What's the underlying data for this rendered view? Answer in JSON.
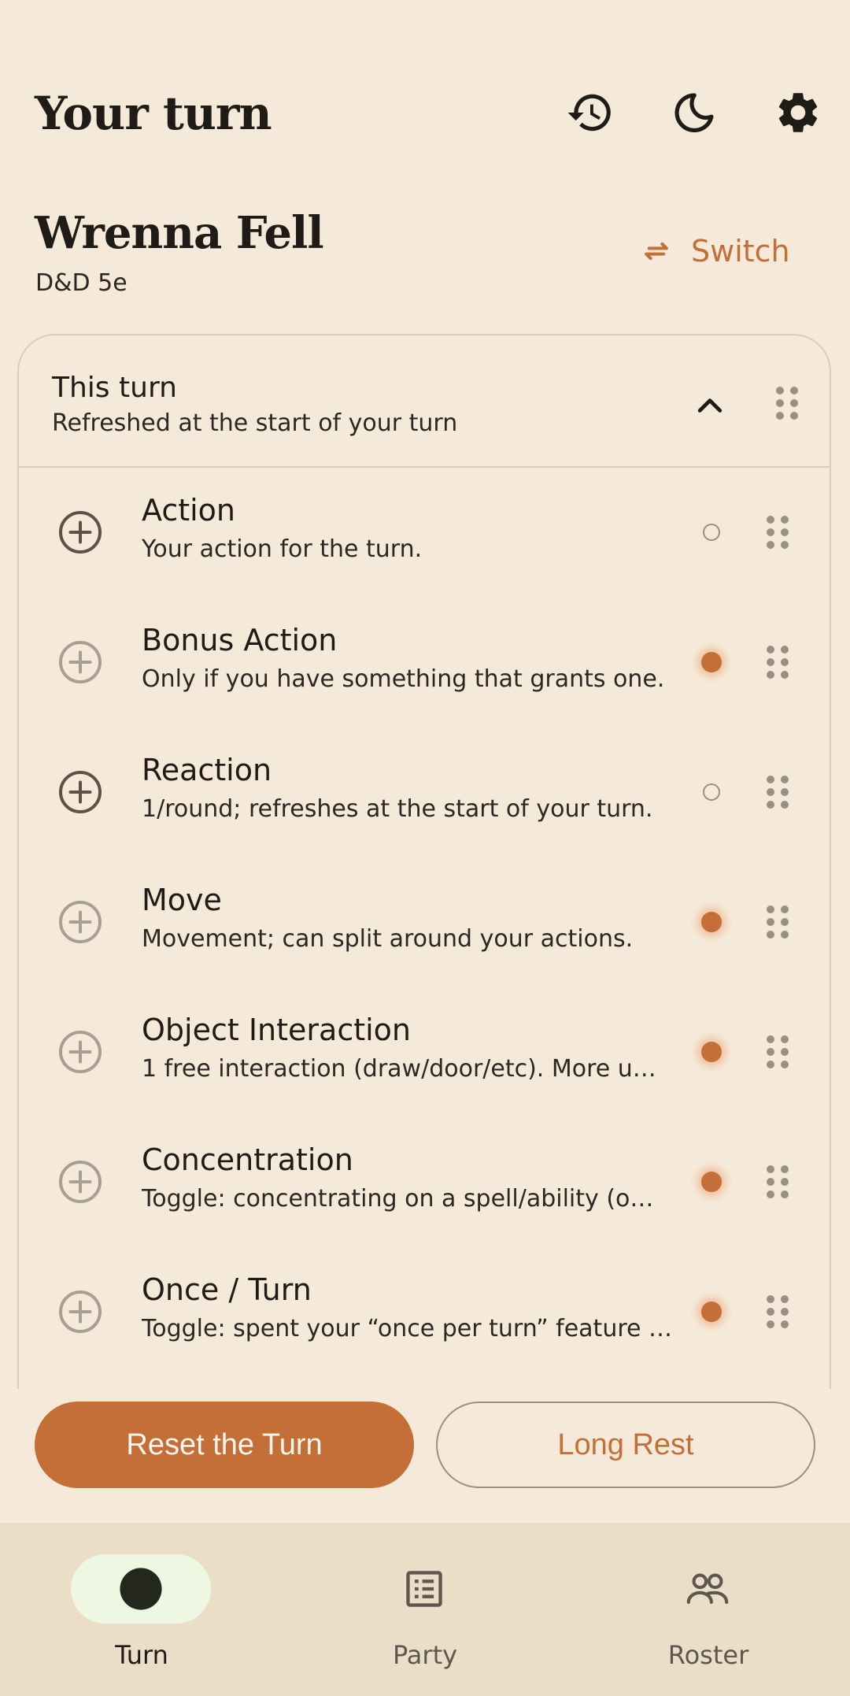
{
  "header": {
    "title": "Your turn",
    "icons": [
      "history-icon",
      "dark-mode-icon",
      "settings-icon"
    ]
  },
  "character": {
    "name": "Wrenna Fell",
    "system": "D&D 5e",
    "switch_label": "Switch"
  },
  "section": {
    "title": "This turn",
    "subtitle": "Refreshed at the start of your turn",
    "expanded": true
  },
  "items": [
    {
      "name": "Action",
      "desc": "Your action for the turn.",
      "used": false
    },
    {
      "name": "Bonus Action",
      "desc": "Only if you have something that grants one.",
      "used": true
    },
    {
      "name": "Reaction",
      "desc": "1/round; refreshes at the start of your turn.",
      "used": false
    },
    {
      "name": "Move",
      "desc": "Movement; can split around your actions.",
      "used": true
    },
    {
      "name": "Object Interaction",
      "desc": "1 free interaction (draw/door/etc). More u…",
      "used": true
    },
    {
      "name": "Concentration",
      "desc": "Toggle: concentrating on a spell/ability (o…",
      "used": true
    },
    {
      "name": "Once / Turn",
      "desc": "Toggle: spent your “once per turn” feature …",
      "used": true
    }
  ],
  "actions": {
    "reset_label": "Reset the Turn",
    "rest_label": "Long Rest"
  },
  "nav": [
    {
      "label": "Turn",
      "active": true
    },
    {
      "label": "Party",
      "active": false
    },
    {
      "label": "Roster",
      "active": false
    }
  ],
  "colors": {
    "background": "#F5EAD9",
    "accent": "#C46E38",
    "nav_bg": "#EBDEC8",
    "active_pill": "#EEF7E2"
  }
}
